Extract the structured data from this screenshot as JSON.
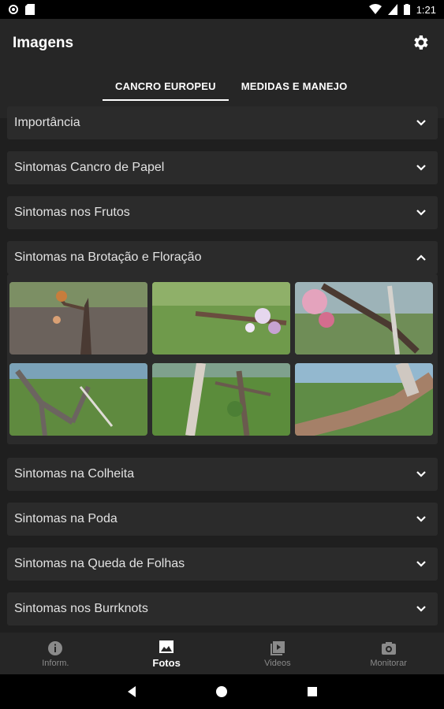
{
  "status_bar": {
    "time": "1:21"
  },
  "app_bar": {
    "title": "Imagens"
  },
  "tabs": [
    {
      "label": "CANCRO EUROPEU"
    },
    {
      "label": "MEDIDAS E MANEJO"
    }
  ],
  "sections": [
    {
      "label": "Importância"
    },
    {
      "label": "Sintomas Cancro de Papel"
    },
    {
      "label": "Sintomas nos Frutos"
    },
    {
      "label": "Sintomas na Brotação e Floração"
    },
    {
      "label": "Sintomas na Colheita"
    },
    {
      "label": "Sintomas na Poda"
    },
    {
      "label": "Sintomas na Queda de Folhas"
    },
    {
      "label": "Sintomas nos Burrknots"
    }
  ],
  "bottom_nav": [
    {
      "label": "Inform.",
      "icon": "info-icon"
    },
    {
      "label": "Fotos",
      "icon": "image-icon"
    },
    {
      "label": "Videos",
      "icon": "video-library-icon"
    },
    {
      "label": "Monitorar",
      "icon": "camera-icon"
    }
  ],
  "colors": {
    "background": "#1f1f1f",
    "app_bar": "#262626",
    "card": "#2b2b2b",
    "text": "#e2e2e2",
    "inactive_nav": "#8a8a8a"
  }
}
